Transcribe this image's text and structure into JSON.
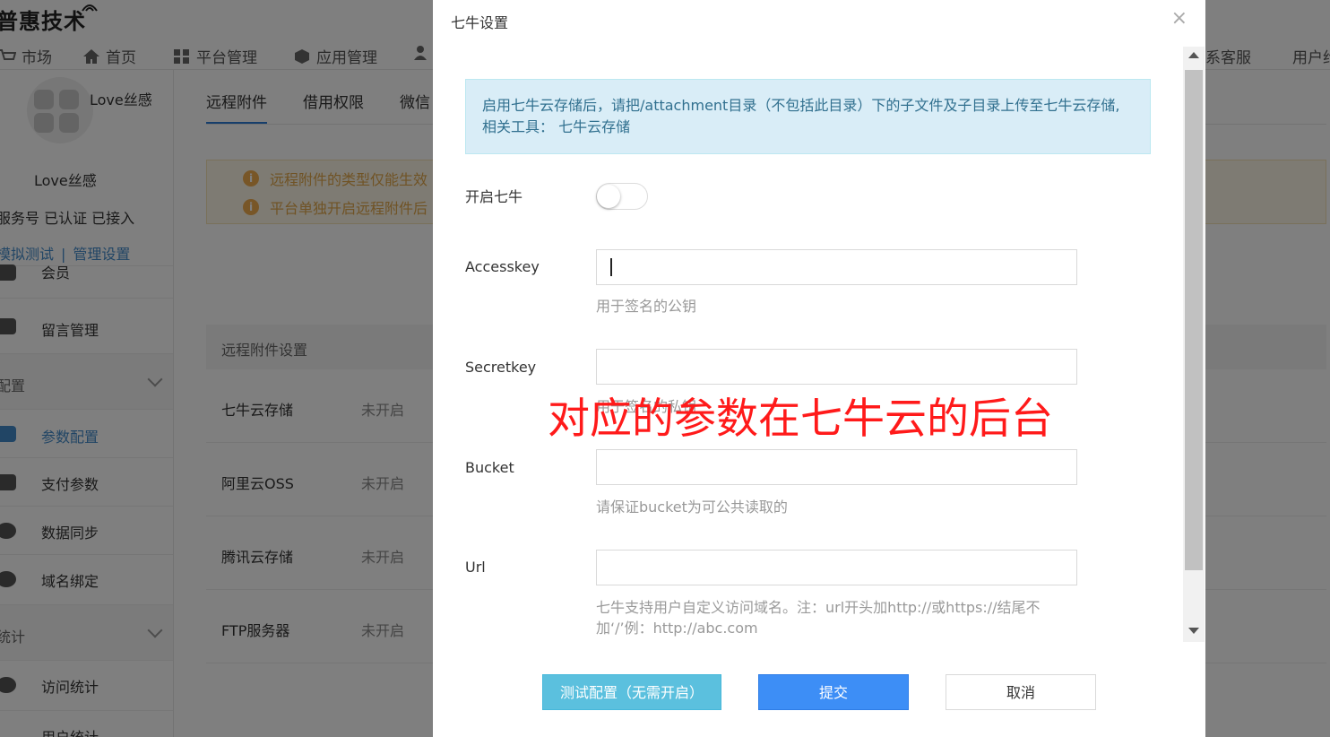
{
  "app": {
    "logo_text": "普惠技术"
  },
  "nav": {
    "items": [
      {
        "label": "市场",
        "icon": "cart-icon"
      },
      {
        "label": "首页",
        "icon": "home-icon"
      },
      {
        "label": "平台管理",
        "icon": "grid-icon"
      },
      {
        "label": "应用管理",
        "icon": "cube-icon"
      },
      {
        "label": "",
        "icon": "users-icon"
      },
      {
        "label": "系客服",
        "icon": ""
      },
      {
        "label": "用户约",
        "icon": ""
      }
    ]
  },
  "sidebar": {
    "account_name_top": "Love丝感",
    "account_name": "Love丝感",
    "status": "服务号 已认证 已接入",
    "link_test": "模拟测试",
    "link_sep": "|",
    "link_manage": "管理设置",
    "items": [
      {
        "label": "会员"
      },
      {
        "label": "留言管理"
      },
      {
        "label": "配置",
        "section": true
      },
      {
        "label": "参数配置",
        "active": true
      },
      {
        "label": "支付参数"
      },
      {
        "label": "数据同步"
      },
      {
        "label": "域名绑定"
      },
      {
        "label": "统计",
        "section": true
      },
      {
        "label": "访问统计"
      },
      {
        "label": "用户统计"
      }
    ]
  },
  "main": {
    "tabs": [
      {
        "label": "远程附件",
        "active": true
      },
      {
        "label": "借用权限"
      },
      {
        "label": "微信"
      }
    ],
    "notices": [
      "远程附件的类型仅能生效",
      "平台单独开启远程附件后"
    ],
    "table": {
      "header": "远程附件设置",
      "rows": [
        {
          "name": "七牛云存储",
          "status": "未开启"
        },
        {
          "name": "阿里云OSS",
          "status": "未开启"
        },
        {
          "name": "腾讯云存储",
          "status": "未开启"
        },
        {
          "name": "FTP服务器",
          "status": "未开启"
        }
      ]
    }
  },
  "modal": {
    "title": "七牛设置",
    "close": "×",
    "info_text": "启用七牛云存储后，请把/attachment目录（不包括此目录）下的子文件及子目录上传至七牛云存储, 相关工具： 七牛云存储",
    "enable_label": "开启七牛",
    "enable_on": false,
    "fields": {
      "accesskey": {
        "label": "Accesskey",
        "value": "",
        "help": "用于签名的公钥"
      },
      "secretkey": {
        "label": "Secretkey",
        "value": "",
        "help": "用于签名的私钥"
      },
      "bucket": {
        "label": "Bucket",
        "value": "",
        "help": "请保证bucket为可公共读取的"
      },
      "url": {
        "label": "Url",
        "value": "",
        "help": "七牛支持用户自定义访问域名。注：url开头加http://或https://结尾不加‘/’例：http://abc.com"
      }
    },
    "annotation": "对应的参数在七牛云的后台",
    "buttons": {
      "test": "测试配置（无需开启）",
      "submit": "提交",
      "cancel": "取消"
    }
  },
  "colors": {
    "primary": "#3d8ef6",
    "info_btn": "#5bc0de",
    "annotation": "#ff1a1a",
    "info_bg": "#d9edf7"
  }
}
